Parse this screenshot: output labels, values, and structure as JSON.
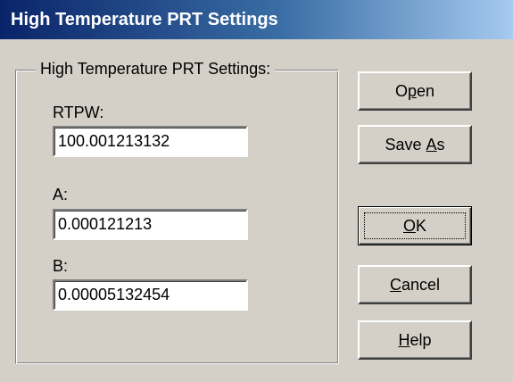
{
  "window": {
    "title": "High Temperature PRT Settings"
  },
  "group": {
    "legend": "High Temperature PRT Settings:"
  },
  "fields": {
    "rtpw": {
      "label": "RTPW:",
      "value": "100.001213132"
    },
    "a": {
      "label": "A:",
      "value": "0.000121213"
    },
    "b": {
      "label": "B:",
      "value": "0.00005132454"
    }
  },
  "buttons": {
    "open": {
      "pre": "O",
      "mnemonic": "p",
      "post": "en"
    },
    "save_as": {
      "pre": "Save ",
      "mnemonic": "A",
      "post": "s"
    },
    "ok": {
      "pre": "",
      "mnemonic": "O",
      "post": "K"
    },
    "cancel": {
      "pre": "",
      "mnemonic": "C",
      "post": "ancel"
    },
    "help": {
      "pre": "",
      "mnemonic": "H",
      "post": "elp"
    }
  },
  "colors": {
    "titlebar_start": "#0a246a",
    "titlebar_end": "#a6caf0",
    "face": "#d4d0c8"
  }
}
